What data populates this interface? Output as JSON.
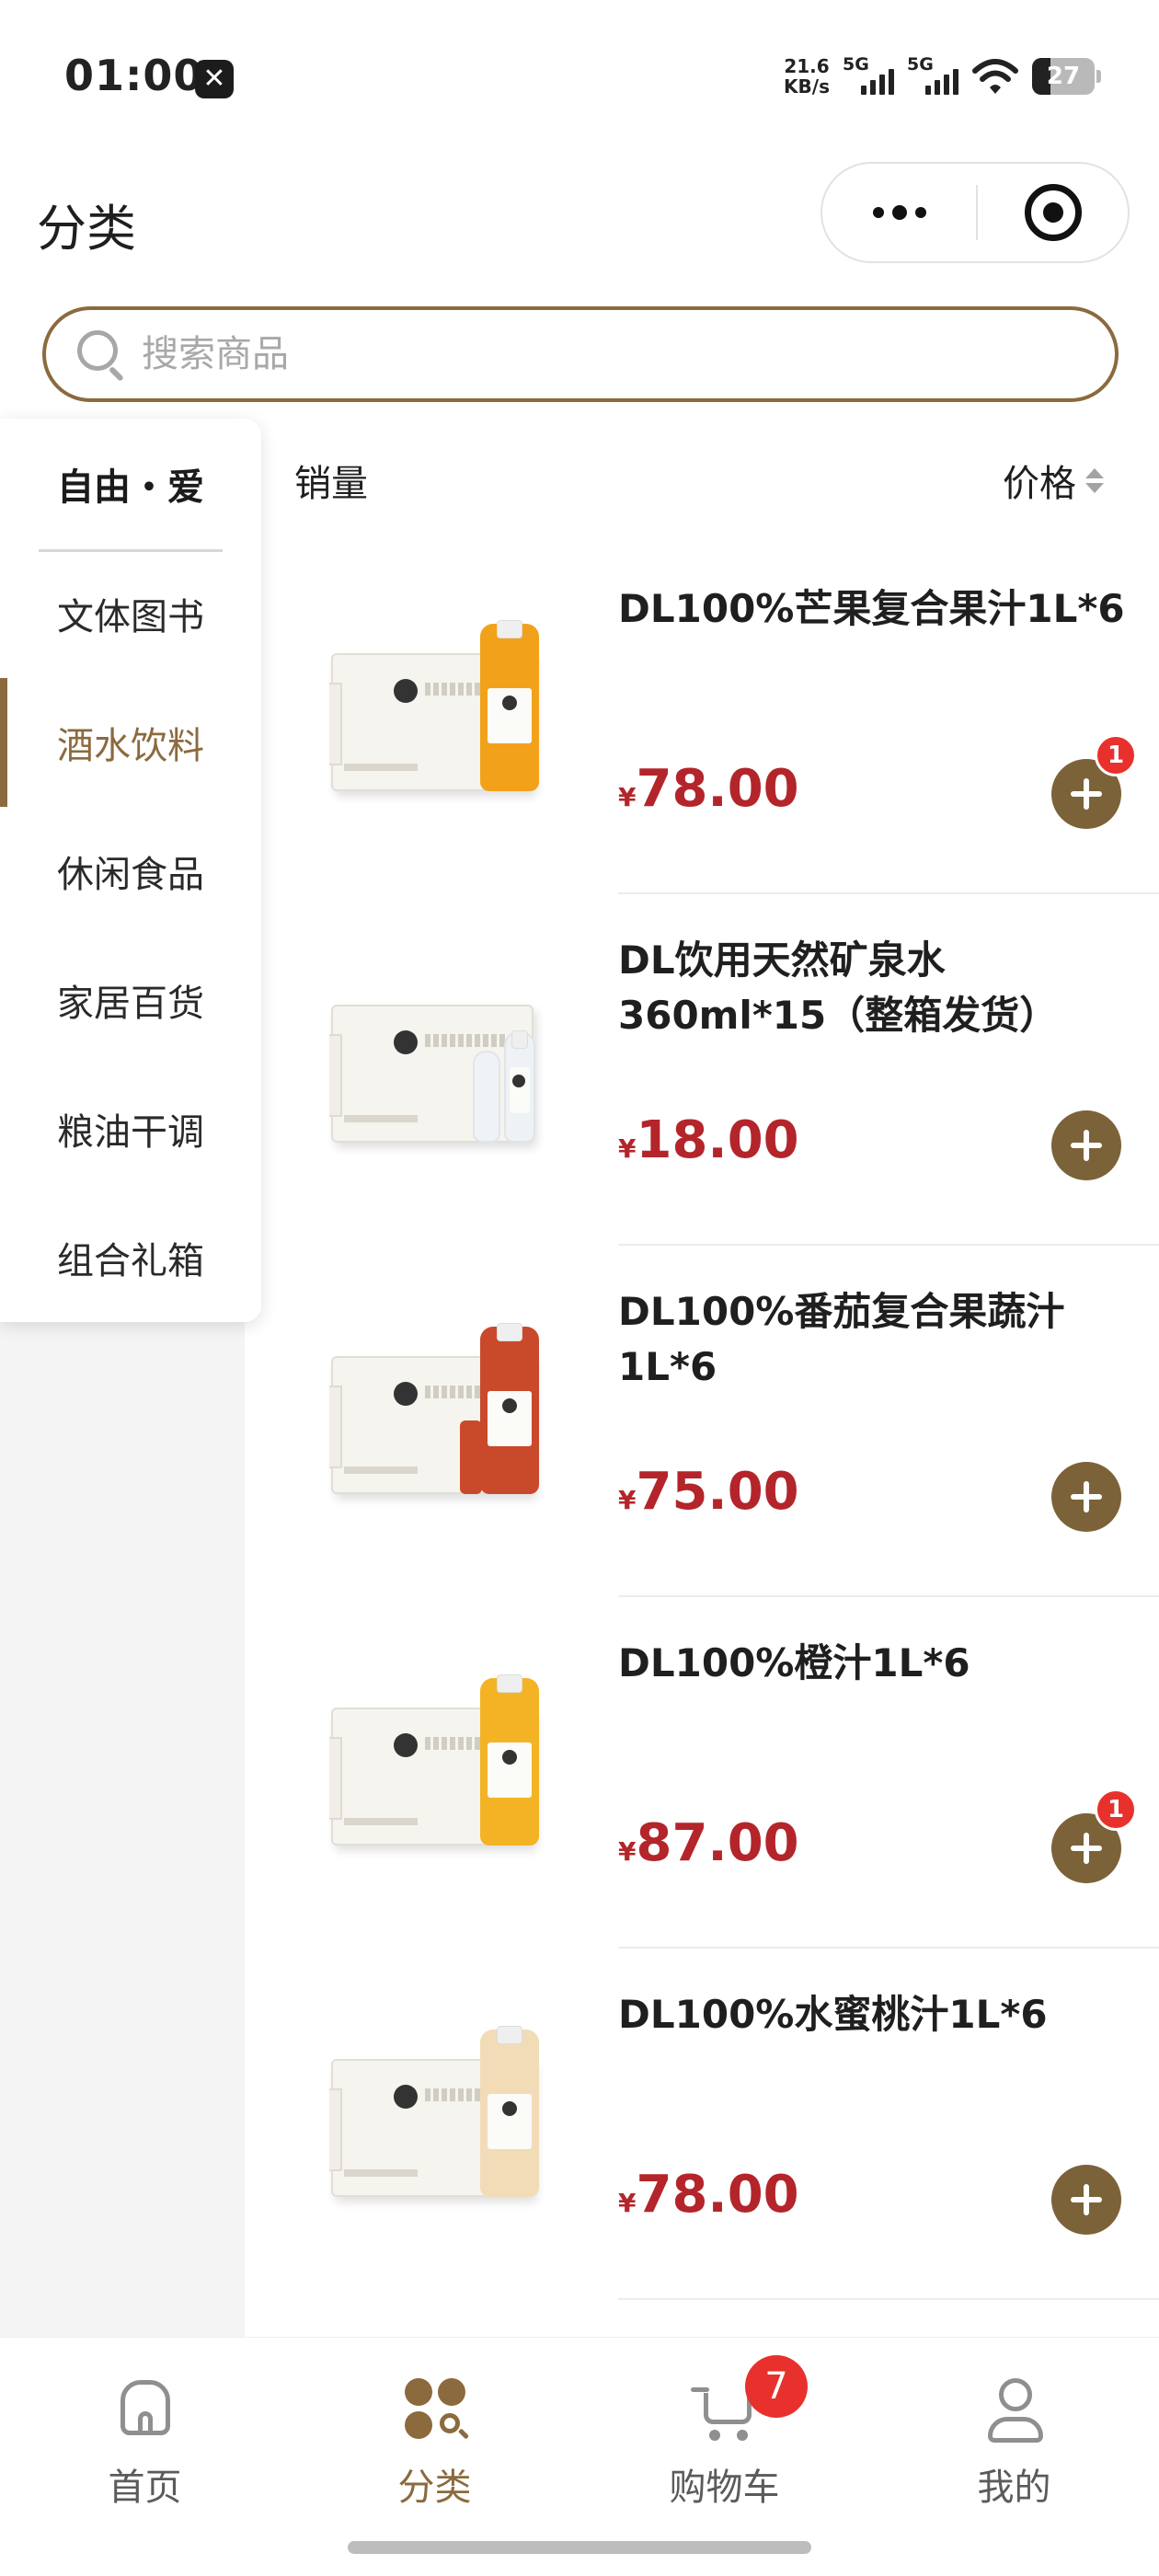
{
  "status_bar": {
    "time": "01:00",
    "speed_value": "21.6",
    "speed_unit": "KB/s",
    "signal1_label": "5G",
    "signal2_label": "5G",
    "battery": "27",
    "app_icon": "x-app-icon"
  },
  "header": {
    "title": "分类"
  },
  "search": {
    "placeholder": "搜索商品"
  },
  "sidebar": {
    "first": "自由・爱",
    "items": [
      {
        "label": "文体图书"
      },
      {
        "label": "酒水饮料"
      },
      {
        "label": "休闲食品"
      },
      {
        "label": "家居百货"
      },
      {
        "label": "粮油干调"
      },
      {
        "label": "组合礼箱"
      }
    ],
    "active_index": 1
  },
  "sort": {
    "sales": "销量",
    "price": "价格"
  },
  "products": [
    {
      "name": "DL100%芒果复合果汁1L*6",
      "currency": "¥",
      "price": "78.00",
      "badge": "1",
      "bottle_color": "#f2a21a"
    },
    {
      "name": "DL饮用天然矿泉水360ml*15（整箱发货）",
      "currency": "¥",
      "price": "18.00",
      "badge": "",
      "bottle_color": "#eef2f4"
    },
    {
      "name": "DL100%番茄复合果蔬汁1L*6",
      "currency": "¥",
      "price": "75.00",
      "badge": "",
      "bottle_color": "#c94a2b"
    },
    {
      "name": "DL100%橙汁1L*6",
      "currency": "¥",
      "price": "87.00",
      "badge": "1",
      "bottle_color": "#f4b324"
    },
    {
      "name": "DL100%水蜜桃汁1L*6",
      "currency": "¥",
      "price": "78.00",
      "badge": "",
      "bottle_color": "#f2dcb8"
    }
  ],
  "tabbar": {
    "home": "首页",
    "category": "分类",
    "cart": "购物车",
    "cart_badge": "7",
    "me": "我的"
  },
  "colors": {
    "accent": "#8b6a3e",
    "price": "#b3252b",
    "badge": "#e8312d"
  }
}
